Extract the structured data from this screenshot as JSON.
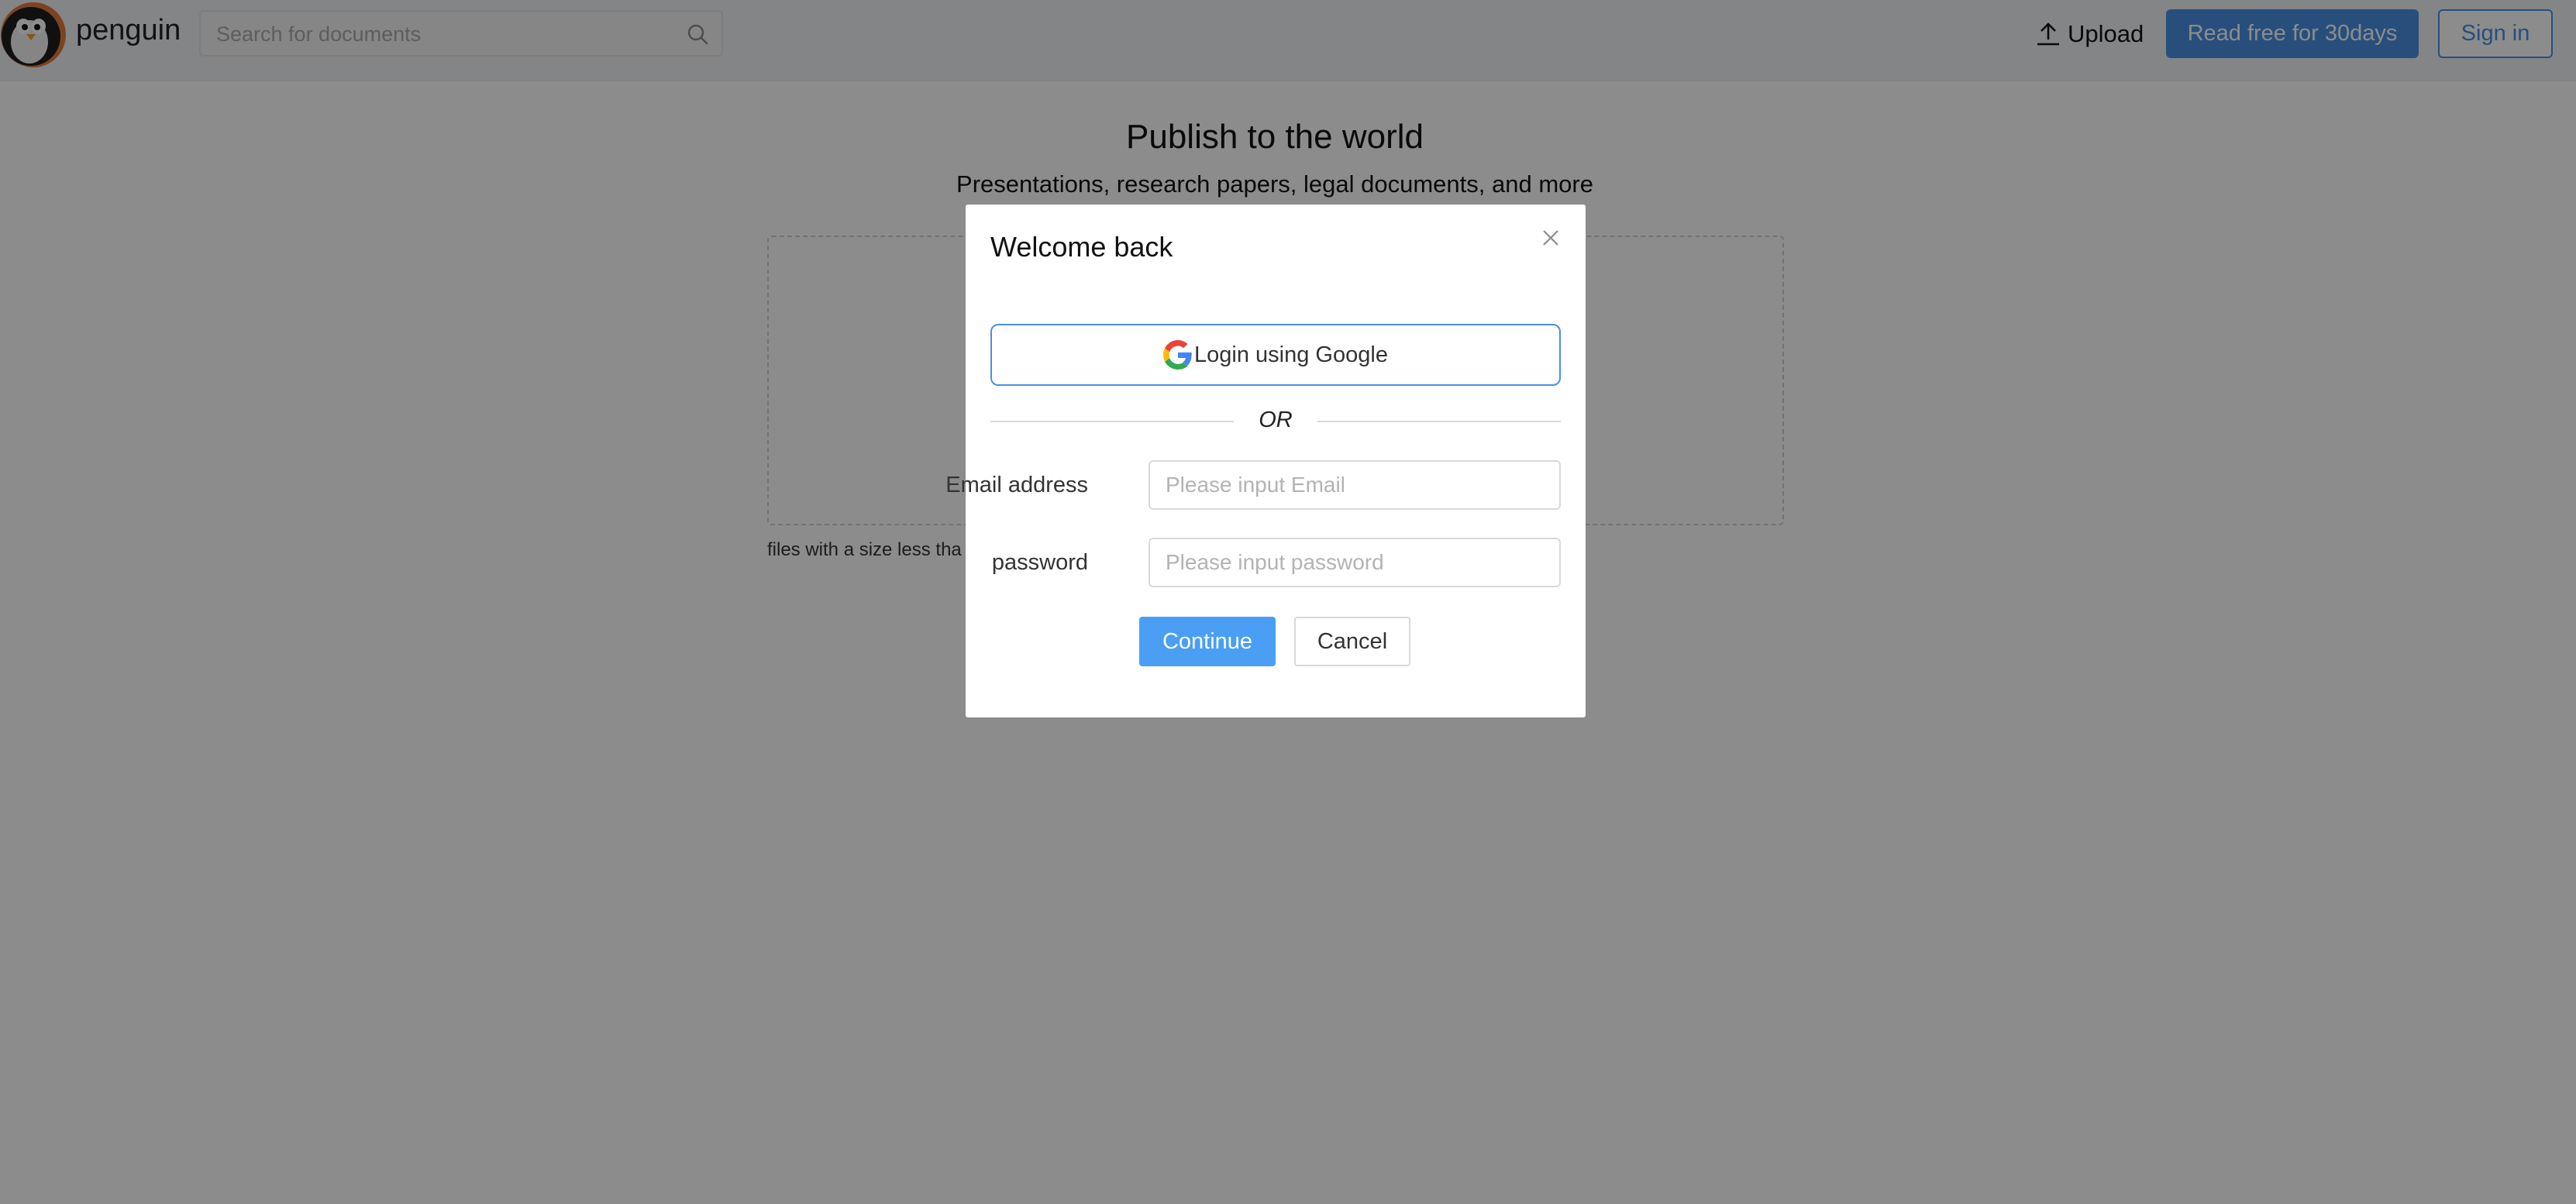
{
  "header": {
    "brand": "penguin",
    "search_placeholder": "Search for documents",
    "upload_label": "Upload",
    "read_free_label": "Read free for 30days",
    "signin_label": "Sign in"
  },
  "main": {
    "title": "Publish to the world",
    "subtitle": "Presentations, research papers, legal documents, and more",
    "size_note": "files with a size less tha"
  },
  "modal": {
    "title": "Welcome back",
    "google_label": "Login using Google",
    "or_label": "OR",
    "email_label": "Email address",
    "email_placeholder": "Please input Email",
    "password_label": "password",
    "password_placeholder": "Please input password",
    "continue_label": "Continue",
    "cancel_label": "Cancel"
  },
  "colors": {
    "primary": "#4a90e2",
    "continue": "#4a9ff5",
    "overlay": "rgba(0,0,0,0.45)"
  },
  "icons": [
    "penguin-logo",
    "search-icon",
    "upload-icon",
    "close-icon",
    "google-icon"
  ]
}
